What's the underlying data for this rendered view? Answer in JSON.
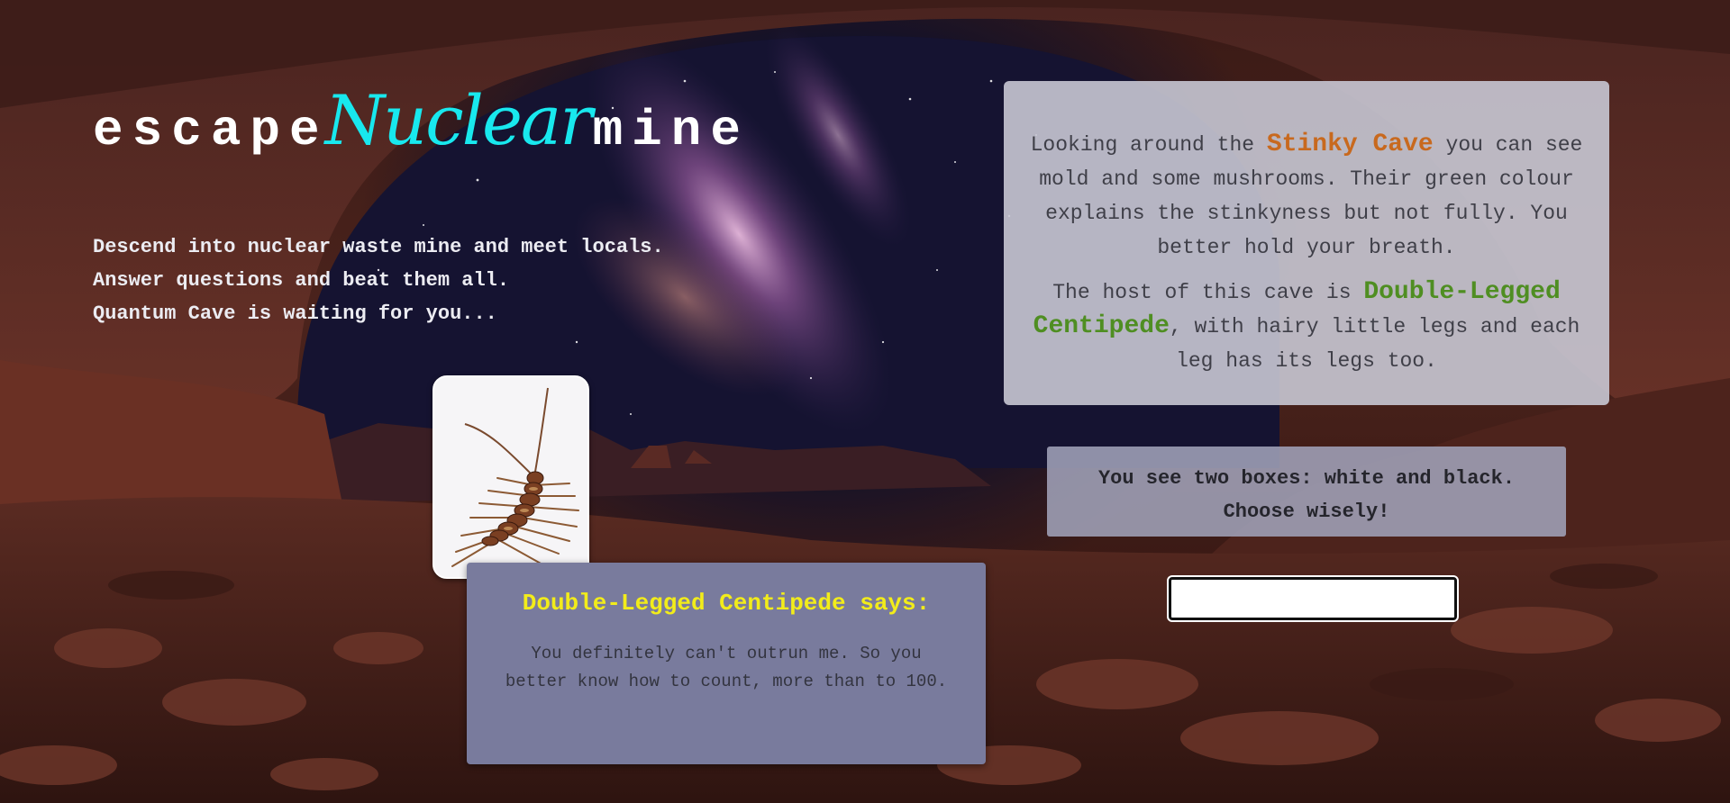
{
  "title": {
    "part1": "escape",
    "part2": "Nuclear",
    "part3": "mine"
  },
  "intro": {
    "line1": "Descend into nuclear waste mine and meet locals.",
    "line2": "Answer questions and beat them all.",
    "line3": "Quantum Cave is waiting for you..."
  },
  "description": {
    "p1_before": "Looking around the ",
    "place": "Stinky Cave",
    "p1_after": " you can see mold and some mushrooms. Their green colour explains the stinkyness but not fully. You better hold your breath.",
    "p2_before": "The host of this cave is ",
    "host": "Double-Legged Centipede",
    "p2_after": ", with hairy little legs and each leg has its legs too."
  },
  "hint": {
    "text": "You see two boxes: white and black. Choose wisely!"
  },
  "answer": {
    "value": "",
    "placeholder": ""
  },
  "creature": {
    "name": "Double-Legged Centipede",
    "icon": "centipede-image"
  },
  "speech": {
    "title": "Double-Legged Centipede says:",
    "text": "You definitely can't outrun me. So you better know how to count, more than to 100."
  },
  "colors": {
    "title_accent": "#18e8ee",
    "place": "#c8691e",
    "host": "#4f8e22",
    "speech_title": "#f2ec1a"
  }
}
